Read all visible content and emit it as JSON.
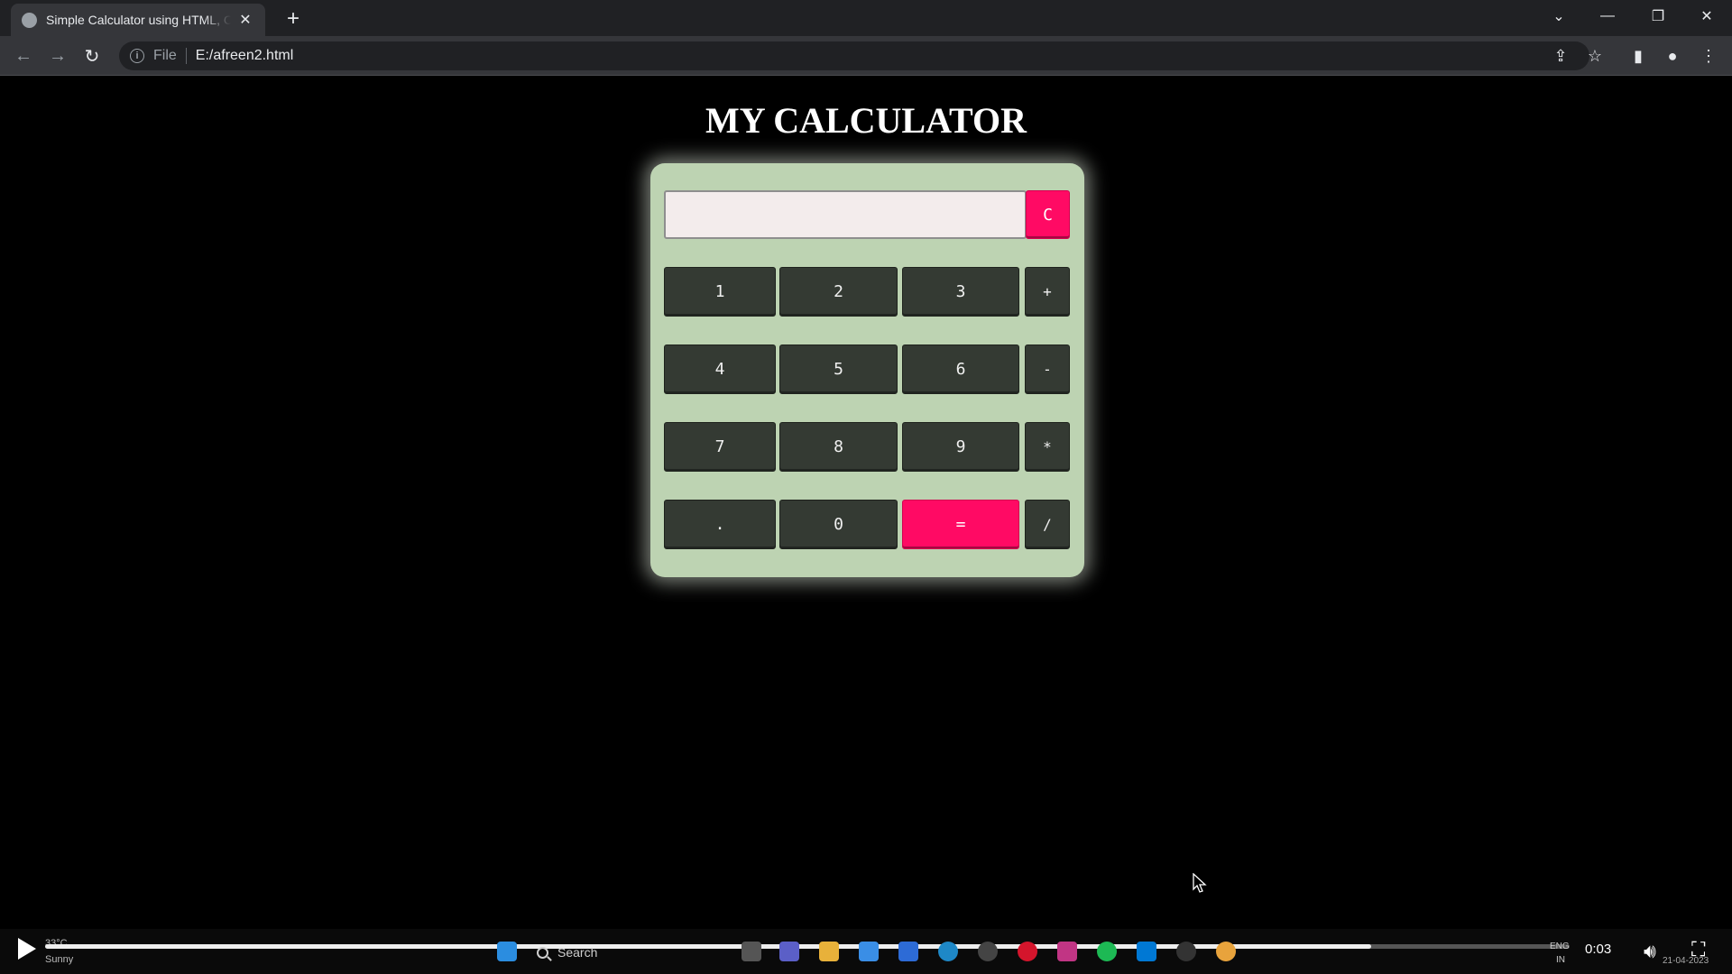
{
  "browser": {
    "tab_title": "Simple Calculator using HTML, CSS",
    "tab_close": "✕",
    "new_tab": "+",
    "scheme": "File",
    "url": "E:/afreen2.html"
  },
  "page": {
    "title": "MY CALCULATOR",
    "display_value": ""
  },
  "calculator": {
    "clear_label": "C",
    "keys": [
      "1",
      "2",
      "3",
      "+",
      "4",
      "5",
      "6",
      "-",
      "7",
      "8",
      "9",
      "*",
      ".",
      "0",
      "=",
      "/"
    ]
  },
  "player": {
    "weather_temp": "33°C",
    "weather_condition": "Sunny",
    "search_placeholder": "Search",
    "time": "0:03",
    "progress_fraction": 0.87,
    "lang_top": "ENG",
    "lang_bottom": "IN",
    "date": "21-04-2023"
  },
  "colors": {
    "accent_pink": "#ff0a64",
    "calculator_body": "#bdd3b2",
    "key_dark": "#343a33"
  }
}
